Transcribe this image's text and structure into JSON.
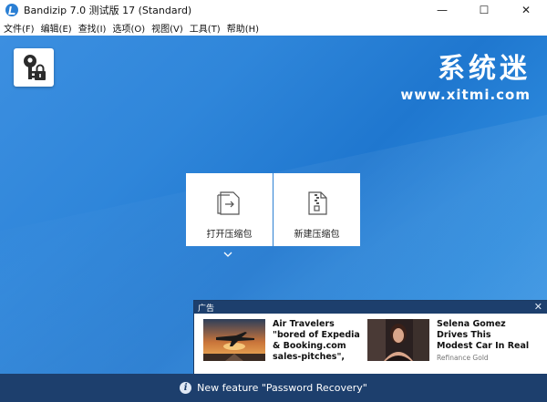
{
  "window": {
    "title": "Bandizip 7.0 测试版 17 (Standard)",
    "minimize": "—",
    "maximize": "☐",
    "close": "✕"
  },
  "menu": [
    "文件(F)",
    "编辑(E)",
    "查找(I)",
    "选项(O)",
    "视图(V)",
    "工具(T)",
    "帮助(H)"
  ],
  "watermark": {
    "title": "系统迷",
    "url": "www.xitmi.com"
  },
  "actions": {
    "open_label": "打开压缩包",
    "new_label": "新建压缩包"
  },
  "ad": {
    "header": "广告",
    "close": "✕",
    "items": [
      {
        "headline": "Air Travelers \"bored of Expedia & Booking.com sales-pitches\", instead start using NEW",
        "source": ""
      },
      {
        "headline": "Selena Gomez Drives This Modest Car In Real Life",
        "source": "Refinance Gold"
      }
    ]
  },
  "status": {
    "text": "New feature \"Password Recovery\""
  },
  "icons": {
    "app": "bandizip-app-icon",
    "key": "key-lock-icon",
    "open": "open-archive-icon",
    "new": "new-archive-icon",
    "expand": "chevron-down-icon",
    "info": "info-icon"
  },
  "colors": {
    "background": "#2f86da",
    "statusbar": "#1d3f6d",
    "ad_header": "#1d3f6d"
  }
}
